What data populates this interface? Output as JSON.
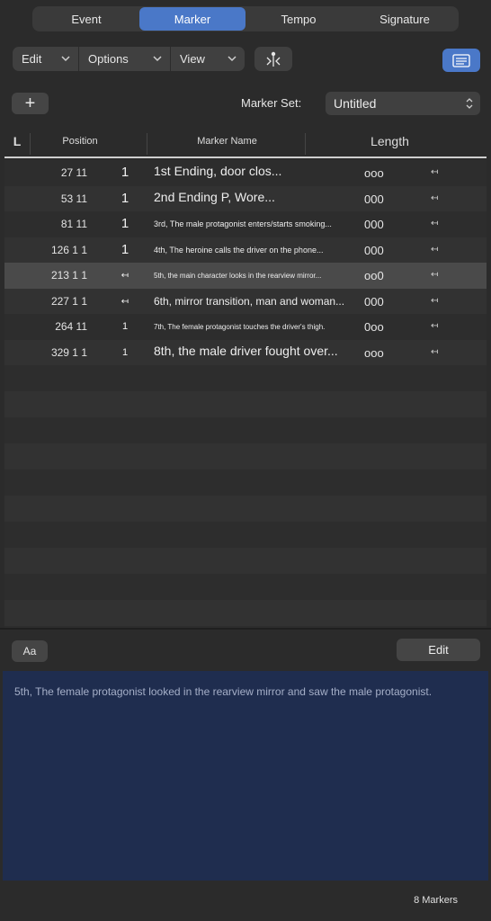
{
  "tabs": [
    {
      "label": "Event",
      "active": false
    },
    {
      "label": "Marker",
      "active": true
    },
    {
      "label": "Tempo",
      "active": false
    },
    {
      "label": "Signature",
      "active": false
    }
  ],
  "toolbar": {
    "edit_label": "Edit",
    "options_label": "Options",
    "view_label": "View",
    "snap_icon": "snap-to-position-icon",
    "list_icon": "list-view-icon"
  },
  "marker_set": {
    "add_label": "+",
    "label": "Marker Set:",
    "value": "Untitled"
  },
  "table": {
    "headers": {
      "lock": "L",
      "position": "Position",
      "name": "Marker Name",
      "length": "Length"
    },
    "rows": [
      {
        "position": "27 11",
        "number": "1",
        "name": "1st Ending, door clos...",
        "length": "ooo",
        "end": "↤",
        "size": "l",
        "selected": false
      },
      {
        "position": "53 11",
        "number": "1",
        "name": "2nd Ending P, Wore...",
        "length": "000",
        "end": "↤",
        "size": "l",
        "selected": false
      },
      {
        "position": "81 11",
        "number": "1",
        "name": "3rd, The male protagonist enters/starts smoking...",
        "length": "000",
        "end": "↤",
        "size": "s",
        "selected": false
      },
      {
        "position": "126 1 1",
        "number": "1",
        "name": "4th, The heroine calls the driver on the phone...",
        "length": "000",
        "end": "↤",
        "size": "s",
        "selected": false
      },
      {
        "position": "213 1 1",
        "number": "↤",
        "name": "5th, the main character looks in the rearview mirror...",
        "length": "oo0",
        "end": "↤",
        "size": "xs",
        "selected": true
      },
      {
        "position": "227 1 1",
        "number": "↤",
        "name": "6th, mirror transition, man and woman...",
        "length": "000",
        "end": "↤",
        "size": "m",
        "selected": false
      },
      {
        "position": "264 11",
        "number": "1",
        "name": "7th, The female protagonist touches the driver's thigh.",
        "length": "0oo",
        "end": "↤",
        "size": "xs",
        "selected": false
      },
      {
        "position": "329 1 1",
        "number": "1",
        "name": "8th, the male driver fought over...",
        "length": "ooo",
        "end": "↤",
        "size": "l",
        "selected": false
      }
    ]
  },
  "notes": {
    "font_button": "Aa",
    "edit_button": "Edit",
    "text": "5th, The female protagonist looked in the rearview mirror and saw the male protagonist."
  },
  "status": {
    "count": "8 Markers"
  },
  "colors": {
    "accent": "#4a78c8",
    "background": "#2b2b2b",
    "note_background": "#1f2d4f"
  }
}
